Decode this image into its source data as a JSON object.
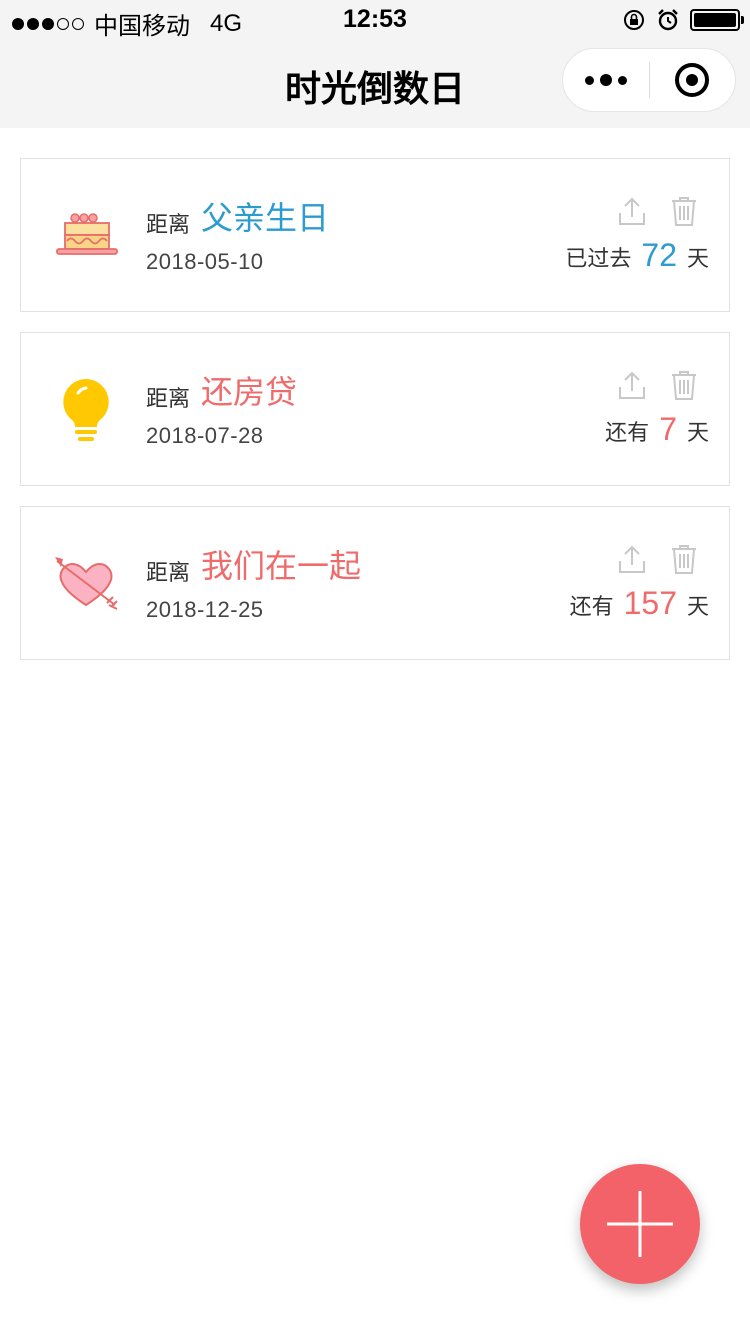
{
  "status_bar": {
    "carrier": "中国移动",
    "network": "4G",
    "time": "12:53"
  },
  "navbar": {
    "title": "时光倒数日"
  },
  "events": [
    {
      "icon": "cake-icon",
      "label": "距离",
      "name": "父亲生日",
      "name_color": "#2c9bd0",
      "date": "2018-05-10",
      "status": "已过去",
      "days": "72",
      "unit": "天",
      "days_color": "#2c9bd0"
    },
    {
      "icon": "lightbulb-icon",
      "label": "距离",
      "name": "还房贷",
      "name_color": "#ef6b6b",
      "date": "2018-07-28",
      "status": "还有",
      "days": "7",
      "unit": "天",
      "days_color": "#ef6b6b"
    },
    {
      "icon": "heart-arrow-icon",
      "label": "距离",
      "name": "我们在一起",
      "name_color": "#ef6b6b",
      "date": "2018-12-25",
      "status": "还有",
      "days": "157",
      "unit": "天",
      "days_color": "#ef6b6b"
    }
  ],
  "colors": {
    "fab": "#f36169",
    "nav_bg": "#f4f4f4"
  }
}
